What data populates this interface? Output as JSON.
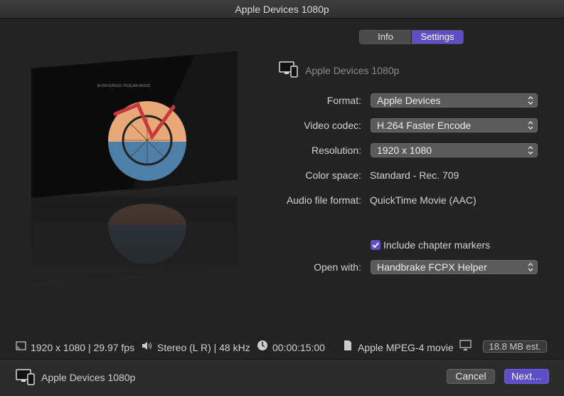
{
  "window": {
    "title": "Apple Devices 1080p"
  },
  "tabs": [
    {
      "label": "Info",
      "selected": false
    },
    {
      "label": "Settings",
      "selected": true
    }
  ],
  "preview": {
    "caption": "IN PROGRESS: PEDLAR MUSIC"
  },
  "device": {
    "name": "Apple Devices 1080p"
  },
  "settings": {
    "format": {
      "label": "Format:",
      "value": "Apple Devices"
    },
    "video_codec": {
      "label": "Video codec:",
      "value": "H.264 Faster Encode"
    },
    "resolution": {
      "label": "Resolution:",
      "value": "1920 x 1080"
    },
    "color_space": {
      "label": "Color space:",
      "value": "Standard - Rec. 709"
    },
    "audio_format": {
      "label": "Audio file format:",
      "value": "QuickTime Movie (AAC)"
    },
    "chapter_markers": {
      "label": "Include chapter markers",
      "checked": true
    },
    "open_with": {
      "label": "Open with:",
      "value": "Handbrake FCPX Helper"
    }
  },
  "infobar": {
    "video": "1920 x 1080 | 29.97 fps",
    "audio": "Stereo (L R) | 48 kHz",
    "duration": "00:00:15:00",
    "file_type": "Apple MPEG-4 movie",
    "size_estimate": "18.8 MB est."
  },
  "footer": {
    "device_name": "Apple Devices 1080p",
    "cancel_label": "Cancel",
    "next_label": "Next…"
  },
  "colors": {
    "accent": "#5d4fc9",
    "background": "#232323"
  }
}
